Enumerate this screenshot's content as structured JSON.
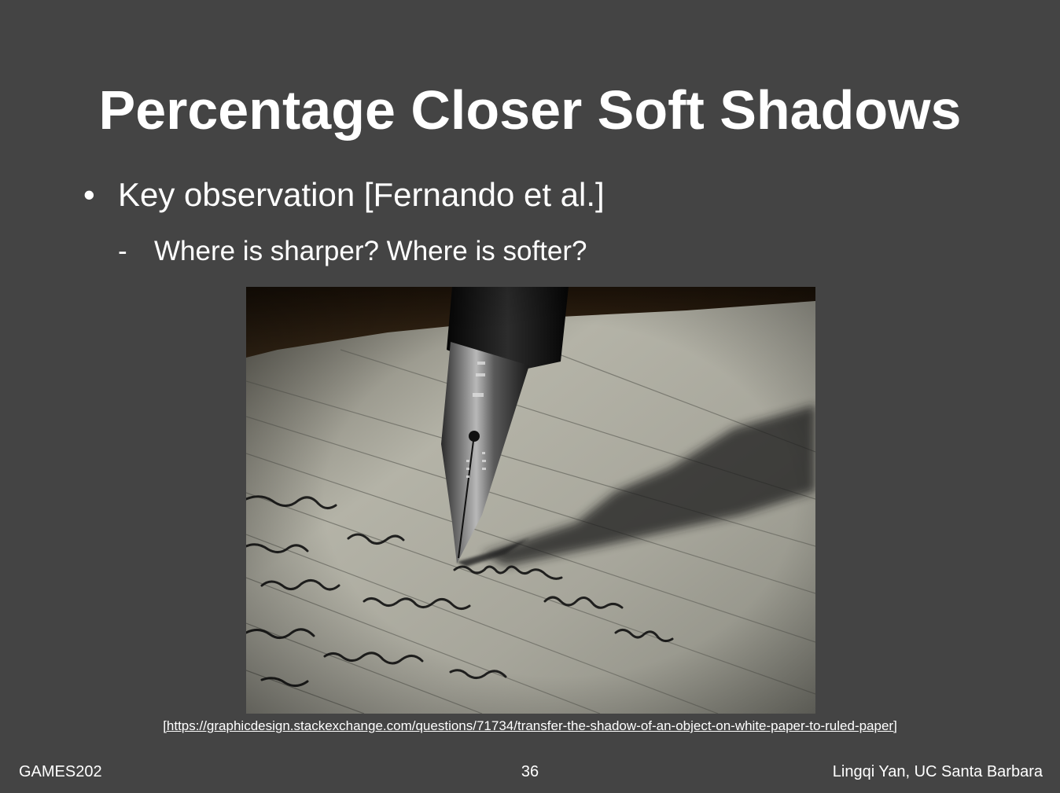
{
  "slide": {
    "title": "Percentage Closer Soft Shadows",
    "bullet": "Key observation [Fernando et al.]",
    "sub_bullet": "Where is sharper? Where is softer?",
    "bullet_marker": "•",
    "sub_bullet_marker": "-"
  },
  "image": {
    "subject": "fountain-pen-nib-shadow-photo",
    "source_link": "[https://graphicdesign.stackexchange.com/questions/71734/transfer-the-shadow-of-an-object-on-white-paper-to-ruled-paper]"
  },
  "footer": {
    "left": "GAMES202",
    "page_number": "36",
    "right": "Lingqi Yan, UC Santa Barbara"
  },
  "colors": {
    "background": "#444444",
    "text": "#ffffff"
  }
}
